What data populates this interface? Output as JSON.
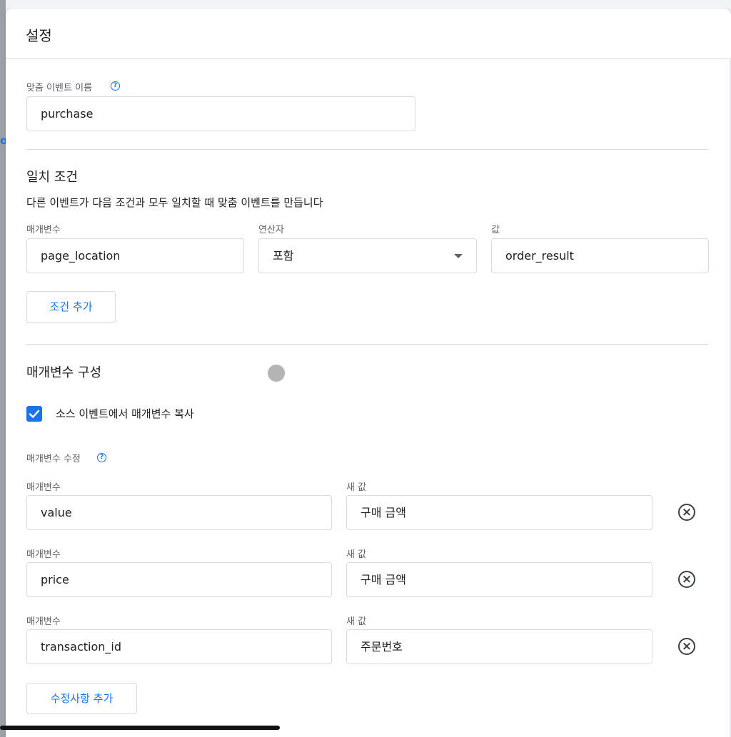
{
  "panel": {
    "title": "설정"
  },
  "custom_event": {
    "label": "맞춤 이벤트 이름",
    "value": "purchase"
  },
  "match": {
    "title": "일치 조건",
    "description": "다른 이벤트가 다음 조건과 모두 일치할 때 맞춤 이벤트를 만듭니다",
    "param_label": "매개변수",
    "operator_label": "연산자",
    "value_label": "값",
    "param_value": "page_location",
    "operator_value": "포함",
    "value_value": "order_result",
    "add_condition": "조건 추가"
  },
  "params": {
    "title": "매개변수 구성",
    "copy_checkbox_label": "소스 이벤트에서 매개변수 복사",
    "copy_checked": true,
    "modify_label": "매개변수 수정",
    "rows": [
      {
        "param_label": "매개변수",
        "param": "value",
        "new_label": "새 값",
        "new_value": "구매 금액"
      },
      {
        "param_label": "매개변수",
        "param": "price",
        "new_label": "새 값",
        "new_value": "구매 금액"
      },
      {
        "param_label": "매개변수",
        "param": "transaction_id",
        "new_label": "새 값",
        "new_value": "주문번호"
      }
    ],
    "add_modification": "수정사항 추가"
  },
  "icons": {
    "help": "help-icon",
    "dropdown": "chevron-down-icon",
    "check": "check-icon",
    "remove": "close-circle-icon"
  },
  "colors": {
    "accent": "#1a73e8",
    "border": "#dadce0",
    "label": "#5f6368",
    "text": "#202124"
  }
}
